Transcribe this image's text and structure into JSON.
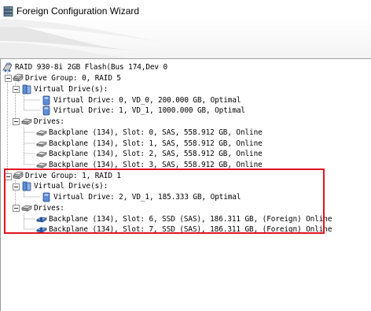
{
  "window": {
    "title": "Foreign Configuration Wizard"
  },
  "tree": {
    "controller": "RAID 930-8i 2GB Flash(Bus 174,Dev 0",
    "groups": [
      {
        "label": "Drive Group: 0, RAID  5",
        "virtual_header": "Virtual Drive(s):",
        "virtual_drives": [
          "Virtual Drive: 0, VD_0, 200.000 GB, Optimal",
          "Virtual Drive: 1, VD_1, 1000.000 GB, Optimal"
        ],
        "drives_header": "Drives:",
        "drives": [
          "Backplane (134), Slot: 0, SAS, 558.912 GB, Online",
          "Backplane (134), Slot: 1, SAS, 558.912 GB, Online",
          "Backplane (134), Slot: 2, SAS, 558.912 GB, Online",
          "Backplane (134), Slot: 3, SAS, 558.912 GB, Online"
        ]
      },
      {
        "label": "Drive Group: 1, RAID  1",
        "virtual_header": "Virtual Drive(s):",
        "virtual_drives": [
          "Virtual Drive: 2, VD_1, 185.333 GB, Optimal"
        ],
        "drives_header": "Drives:",
        "drives": [
          "Backplane (134), Slot: 6, SSD  (SAS), 186.311 GB, (Foreign) Online",
          "Backplane (134), Slot: 7, SSD  (SAS), 186.311 GB, (Foreign) Online"
        ]
      }
    ]
  },
  "icons": {
    "title": "server-stack-icon",
    "controller": "raid-controller-icon",
    "drive_group": "drive-group-icon",
    "virtual_drives_folder": "virtual-drives-icon",
    "virtual_drive": "virtual-drive-icon",
    "drives_folder": "drives-folder-icon",
    "hdd": "hdd-icon",
    "ssd_foreign": "foreign-ssd-icon"
  },
  "colors": {
    "highlight": "#e0141e",
    "tree_line": "#a0a0a0",
    "background": "#ffffff"
  }
}
